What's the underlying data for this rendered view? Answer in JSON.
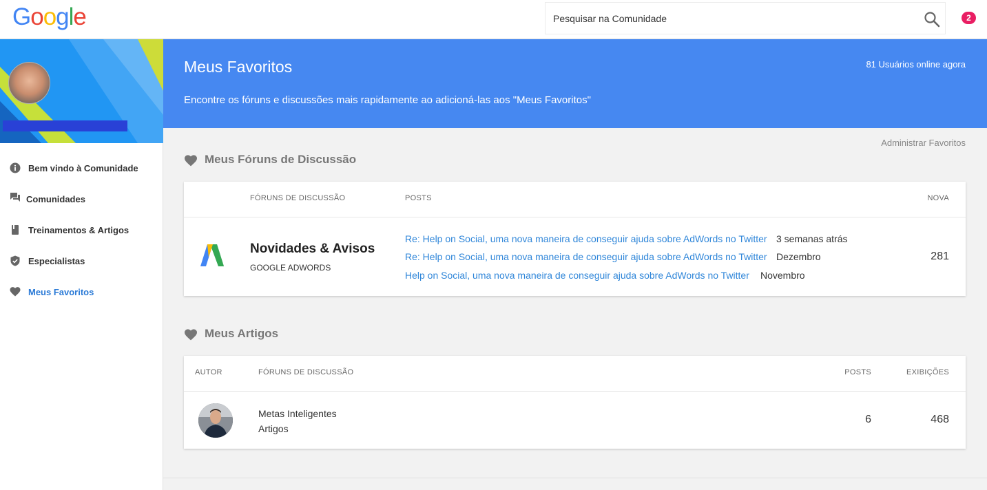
{
  "header": {
    "logo_letters": [
      {
        "ch": "G",
        "color": "#4285F4"
      },
      {
        "ch": "o",
        "color": "#EA4335"
      },
      {
        "ch": "o",
        "color": "#FBBC05"
      },
      {
        "ch": "g",
        "color": "#4285F4"
      },
      {
        "ch": "l",
        "color": "#34A853"
      },
      {
        "ch": "e",
        "color": "#EA4335"
      }
    ],
    "search_placeholder": "Pesquisar na Comunidade",
    "notification_count": "2"
  },
  "sidebar": {
    "items": [
      {
        "label": "Bem vindo à Comunidade",
        "icon": "info-icon",
        "active": false
      },
      {
        "label": "Comunidades",
        "icon": "chat-icon",
        "active": false
      },
      {
        "label": "Treinamentos & Artigos",
        "icon": "book-icon",
        "active": false
      },
      {
        "label": "Especialistas",
        "icon": "shield-icon",
        "active": false
      },
      {
        "label": "Meus Favoritos",
        "icon": "heart-icon",
        "active": true
      }
    ]
  },
  "band": {
    "title": "Meus Favoritos",
    "description": "Encontre os fóruns e discussões mais rapidamente ao adicioná-las aos \"Meus Favoritos\"",
    "online": "81 Usuários online agora"
  },
  "admin_link": "Administrar Favoritos",
  "forums_section": {
    "title": "Meus Fóruns de Discussão",
    "headers": {
      "forum": "Fóruns de Discussão",
      "posts": "Posts",
      "new": "Nova"
    },
    "row": {
      "name": "Novidades & Avisos",
      "sub": "GOOGLE ADWORDS",
      "posts": [
        {
          "title": "Re: Help on Social, uma nova maneira de conseguir ajuda sobre AdWords no Twitter",
          "date": "3 semanas atrás"
        },
        {
          "title": "Re: Help on Social, uma nova maneira de conseguir ajuda sobre AdWords no Twitter",
          "date": "Dezembro"
        },
        {
          "title": "Help on Social, uma nova maneira de conseguir ajuda sobre AdWords no Twitter",
          "date": "Novembro"
        }
      ],
      "new_count": "281"
    }
  },
  "articles_section": {
    "title": "Meus Artigos",
    "headers": {
      "author": "Autor",
      "forum": "Fóruns de Discussão",
      "posts": "Posts",
      "views": "Exibições"
    },
    "row": {
      "title": "Metas Inteligentes",
      "sub": "Artigos",
      "posts": "6",
      "views": "468"
    }
  },
  "colors": {
    "accent": "#4688f1",
    "link": "#2f86d9",
    "badge": "#e91e63"
  }
}
